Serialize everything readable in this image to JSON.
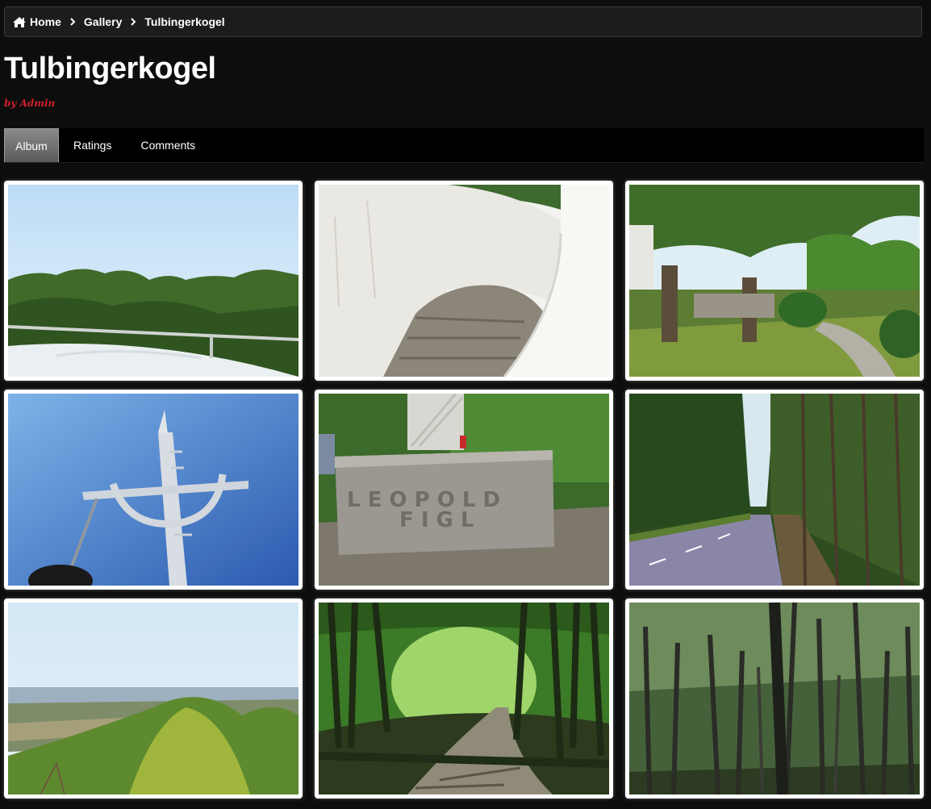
{
  "breadcrumb": {
    "home": "Home",
    "gallery": "Gallery",
    "current": "Tulbingerkogel"
  },
  "page": {
    "title": "Tulbingerkogel",
    "byline": "by Admin"
  },
  "tabs": [
    {
      "label": "Album",
      "active": true
    },
    {
      "label": "Ratings",
      "active": false
    },
    {
      "label": "Comments",
      "active": false
    }
  ],
  "photos": [
    {
      "subject": "tower-view-sky-trees"
    },
    {
      "subject": "spiral-staircase"
    },
    {
      "subject": "restaurant-garden-trees"
    },
    {
      "subject": "cross-antenna-blue-sky"
    },
    {
      "subject": "leopold-figl-stone"
    },
    {
      "subject": "forest-road"
    },
    {
      "subject": "panorama-landscape"
    },
    {
      "subject": "forest-path"
    },
    {
      "subject": "tall-forest"
    }
  ],
  "colors": {
    "background": "#0d0d0d",
    "accent_red": "#d0202a",
    "tab_active": "#7a7a7a"
  }
}
